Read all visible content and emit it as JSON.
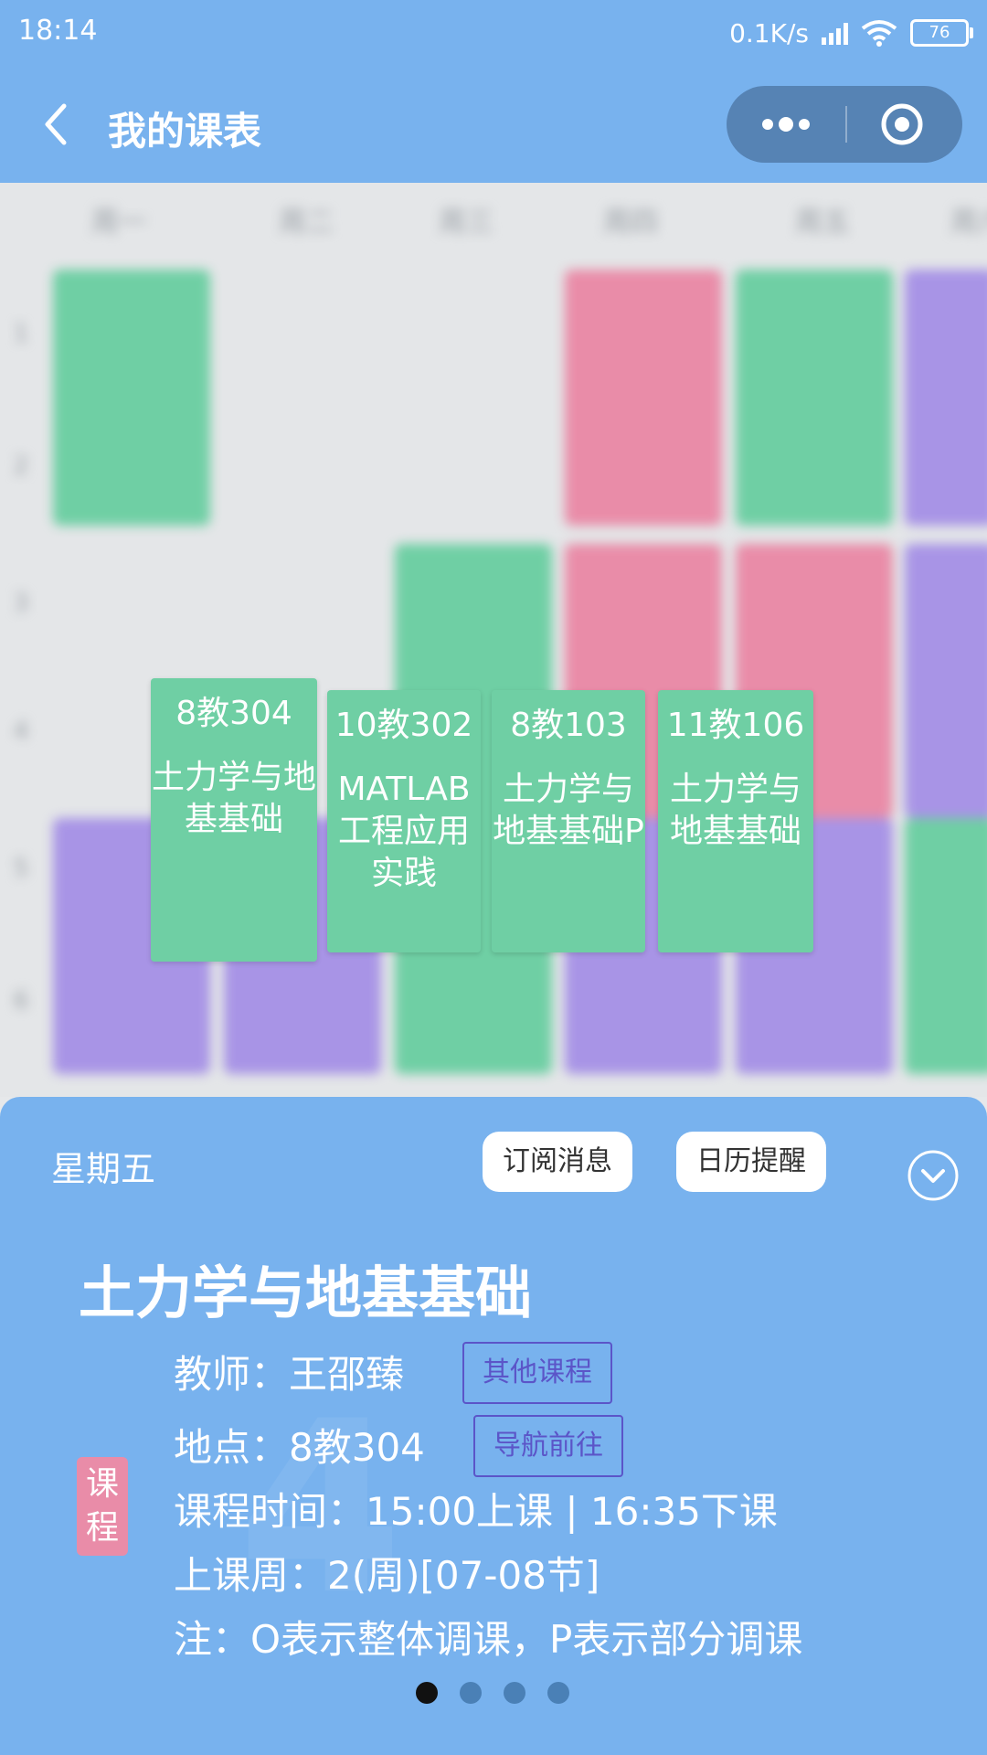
{
  "status_bar": {
    "time": "18:14",
    "net_speed": "0.1K/s",
    "battery": "76"
  },
  "nav": {
    "title": "我的课表"
  },
  "timetable": {
    "day_headers": [
      "周一",
      "周二",
      "周三",
      "周四",
      "周五",
      "周六"
    ],
    "row_numbers": [
      "1",
      "2",
      "3",
      "4",
      "5",
      "6"
    ]
  },
  "course_cards": [
    {
      "location": "8教304",
      "name": "土力学与地基基础"
    },
    {
      "location": "10教302",
      "name": "MATLAB工程应用实践"
    },
    {
      "location": "8教103",
      "name": "土力学与地基基础P"
    },
    {
      "location": "11教106",
      "name": "土力学与地基基础"
    }
  ],
  "detail": {
    "weekday": "星期五",
    "subscribe_label": "订阅消息",
    "calendar_label": "日历提醒",
    "course_name": "土力学与地基基础",
    "teacher": "教师：王邵臻",
    "other_courses_label": "其他课程",
    "location": "地点：8教304",
    "navigate_label": "导航前往",
    "time": "课程时间：15:00上课 | 16:35下课",
    "weeks": "上课周：2(周)[07-08节]",
    "note": "注：O表示整体调课，P表示部分调课",
    "tag": "课程",
    "watermark": "4",
    "page_count": 4,
    "current_page": 1
  },
  "colors": {
    "accent": "#78b2ee",
    "card_green": "#6fcfa4",
    "tag_pink": "#e98ca8",
    "outline_purple": "#5b55c8"
  }
}
